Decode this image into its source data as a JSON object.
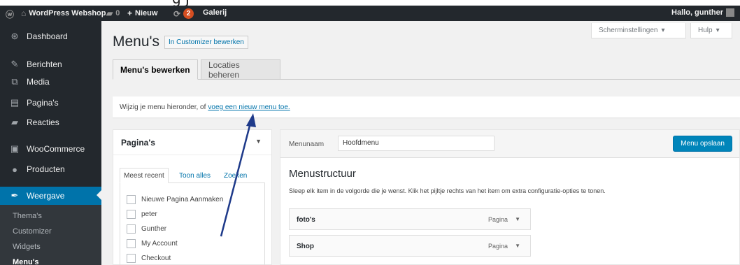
{
  "top_cut_text": "g J",
  "adminbar": {
    "site_name": "WordPress Webshop",
    "comments_count": "0",
    "new_label": "Nieuw",
    "updates_count": "2",
    "gallery_label": "Galerij",
    "greeting": "Hallo, gunther"
  },
  "sidebar": {
    "items": [
      {
        "label": "Dashboard",
        "icon": "dashboard-icon",
        "glyph": "⊛"
      },
      {
        "label": "Berichten",
        "icon": "pin-icon",
        "glyph": "✎"
      },
      {
        "label": "Media",
        "icon": "media-icon",
        "glyph": "⧉"
      },
      {
        "label": "Pagina's",
        "icon": "page-icon",
        "glyph": "▤"
      },
      {
        "label": "Reacties",
        "icon": "comment-icon",
        "glyph": "▰"
      },
      {
        "label": "WooCommerce",
        "icon": "woocommerce-icon",
        "glyph": "▣"
      },
      {
        "label": "Producten",
        "icon": "products-icon",
        "glyph": "●"
      },
      {
        "label": "Weergave",
        "icon": "appearance-icon",
        "glyph": "✒"
      }
    ],
    "submenu": [
      "Thema's",
      "Customizer",
      "Widgets",
      "Menu's"
    ]
  },
  "header": {
    "title": "Menu's",
    "title_link": "In Customizer bewerken",
    "screen_options": "Scherminstellingen",
    "help": "Hulp"
  },
  "tabs": [
    "Menu's bewerken",
    "Locaties beheren"
  ],
  "notice": {
    "text": "Wijzig je menu hieronder, of",
    "link": "voeg een nieuw menu toe."
  },
  "pages_box": {
    "title": "Pagina's",
    "tabs": [
      "Meest recent",
      "Toon alles",
      "Zoeken"
    ],
    "items": [
      "Nieuwe Pagina Aanmaken",
      "peter",
      "Gunther",
      "My Account",
      "Checkout"
    ]
  },
  "menu_editor": {
    "name_label": "Menunaam",
    "name_value": "Hoofdmenu",
    "save_label": "Menu opslaan",
    "structure_title": "Menustructuur",
    "structure_desc": "Sleep elk item in de volgorde die je wenst. Klik het pijltje rechts van het item om extra configuratie-opties te tonen.",
    "items": [
      {
        "label": "foto's",
        "type": "Pagina"
      },
      {
        "label": "Shop",
        "type": "Pagina"
      }
    ]
  },
  "colors": {
    "admin_dark": "#23282d",
    "accent": "#0073aa",
    "annotation_arrow": "#1e3a8a"
  }
}
